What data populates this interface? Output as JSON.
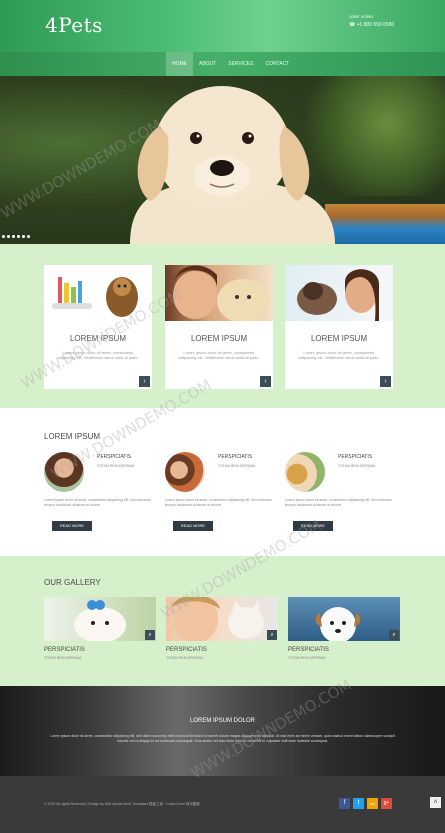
{
  "header": {
    "logo": "4Pets",
    "order_label": "order online:",
    "phone": "☎ +1 800 559 6580"
  },
  "nav": [
    "HOME",
    "ABOUT",
    "SERVICES",
    "CONTACT"
  ],
  "hero": {
    "slides": 6
  },
  "features": [
    {
      "title": "LOREM IPSUM",
      "text": "Lorem ipsum dolor sit amet, consectetur adipiscing elit. Vestibulum lacus nulla at justo.",
      "image": "pet-products-and-yorkie"
    },
    {
      "title": "LOREM IPSUM",
      "text": "Lorem ipsum dolor sit amet, consectetur adipiscing elit. Vestibulum lacus nulla at justo.",
      "image": "woman-with-puppy"
    },
    {
      "title": "LOREM IPSUM",
      "text": "Lorem ipsum dolor sit amet, consectetur adipiscing elit. Vestibulum lacus nulla at justo.",
      "image": "woman-kissing-dog"
    }
  ],
  "about": {
    "title": "LOREM IPSUM",
    "columns": [
      {
        "heading": "PERSPICIATIS",
        "sub": "TOTAM REM APERIAM",
        "text": "Lorem ipsum dolor sit amet, consectetur adipiscing elit. Sed eiusmod tempor incididunt ut labore et dolore.",
        "button": "READ MORE"
      },
      {
        "heading": "PERSPICIATIS",
        "sub": "TOTAM REM APERIAM",
        "text": "Lorem ipsum dolor sit amet, consectetur adipiscing elit. Sed eiusmod tempor incididunt ut labore et dolore.",
        "button": "READ MORE"
      },
      {
        "heading": "PERSPICIATIS",
        "sub": "TOTAM REM APERIAM",
        "text": "Lorem ipsum dolor sit amet, consectetur adipiscing elit. Sed eiusmod tempor incididunt ut labore et dolore.",
        "button": "READ MORE"
      }
    ]
  },
  "gallery": {
    "title": "OUR GALLERY",
    "items": [
      {
        "heading": "PERSPICIATIS",
        "sub": "TOTAM REM APERIAM"
      },
      {
        "heading": "PERSPICIATIS",
        "sub": "TOTAM REM APERIAM"
      },
      {
        "heading": "PERSPICIATIS",
        "sub": "TOTAM REM APERIAM"
      }
    ]
  },
  "banner": {
    "title": "LOREM IPSUM DOLOR",
    "text": "Lorem ipsum dolor sit amet, consectetur adipiscing elit, sed diam nonummy nibh euismod tincidunt ut laoreet dolore magna aliquam erat volutpat. Ut wisi enim ad minim veniam, quis nostrud exerci tation ullamcorper suscipit lobortis nisl ut aliquip ex ea commodo consequat. Duis autem vel eum iriure dolor in hendrerit in vulputate velit esse molestie consequat."
  },
  "footer": {
    "copyright": "© 2015 All rights Reserved | Design by W3Layouts More Templates 模板之家 - Collect from 网页模板",
    "social": [
      "f",
      "t",
      "rss",
      "g+"
    ],
    "to_top": "˄"
  },
  "watermark": "WWW.DOWNDEMO.COM",
  "colors": {
    "green": "#4fbf76",
    "mint": "#d7f0cc",
    "dark": "#3b4d57",
    "facebook": "#3b5998",
    "twitter": "#1da1f2",
    "rss": "#f2a400",
    "gplus": "#dd4b39"
  }
}
